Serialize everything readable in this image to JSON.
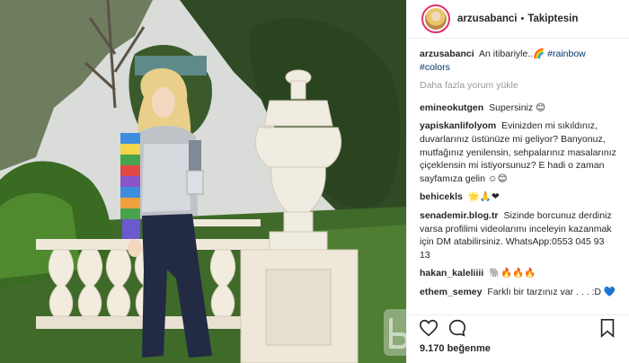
{
  "post": {
    "username": "arzusabanci",
    "follow_label": "Takiptesin",
    "caption_text": "An itibariyle..",
    "caption_emoji": "🌈",
    "caption_tags": [
      "#rainbow",
      "#colors"
    ],
    "load_more": "Daha fazla yorum yükle",
    "likes": "9.170 beğenme"
  },
  "comments": [
    {
      "user": "emineokutgen",
      "text": "Supersiniz",
      "emoji": "😊"
    },
    {
      "user": "yapiskanlifolyom",
      "text": "Evinizden mi sıkıldınız, duvarlarınız üstünüze mi geliyor? Banyonuz, mutfağınız yenilensin, sehpalarınız masalarınız çiçeklensin mi istiyorsunuz? E hadi o zaman sayfamıza gelin",
      "emoji": "☺😊"
    },
    {
      "user": "behicekls",
      "text": "",
      "emoji": "🌟🙏❤"
    },
    {
      "user": "senademir.blog.tr",
      "text": "Sizinde borcunuz derdiniz varsa profilimi videolarımı inceleyin kazanmak için DM atabilirsiniz. WhatsApp:0553 045 93 13",
      "emoji": ""
    },
    {
      "user": "hakan_kaleliiii",
      "text": "",
      "emoji": "🐘🔥🔥🔥"
    },
    {
      "user": "ethem_semey",
      "text": "Farklı bir tarzınız var . . . :D",
      "emoji": "💙"
    },
    {
      "user": "",
      "text": "",
      "emoji": "💛💚🐻🌈👍"
    }
  ],
  "colors": {
    "accent": "#e1306c",
    "link": "#003569",
    "muted": "#999999"
  },
  "icons": [
    "heart-icon",
    "comment-icon",
    "bookmark-icon"
  ]
}
